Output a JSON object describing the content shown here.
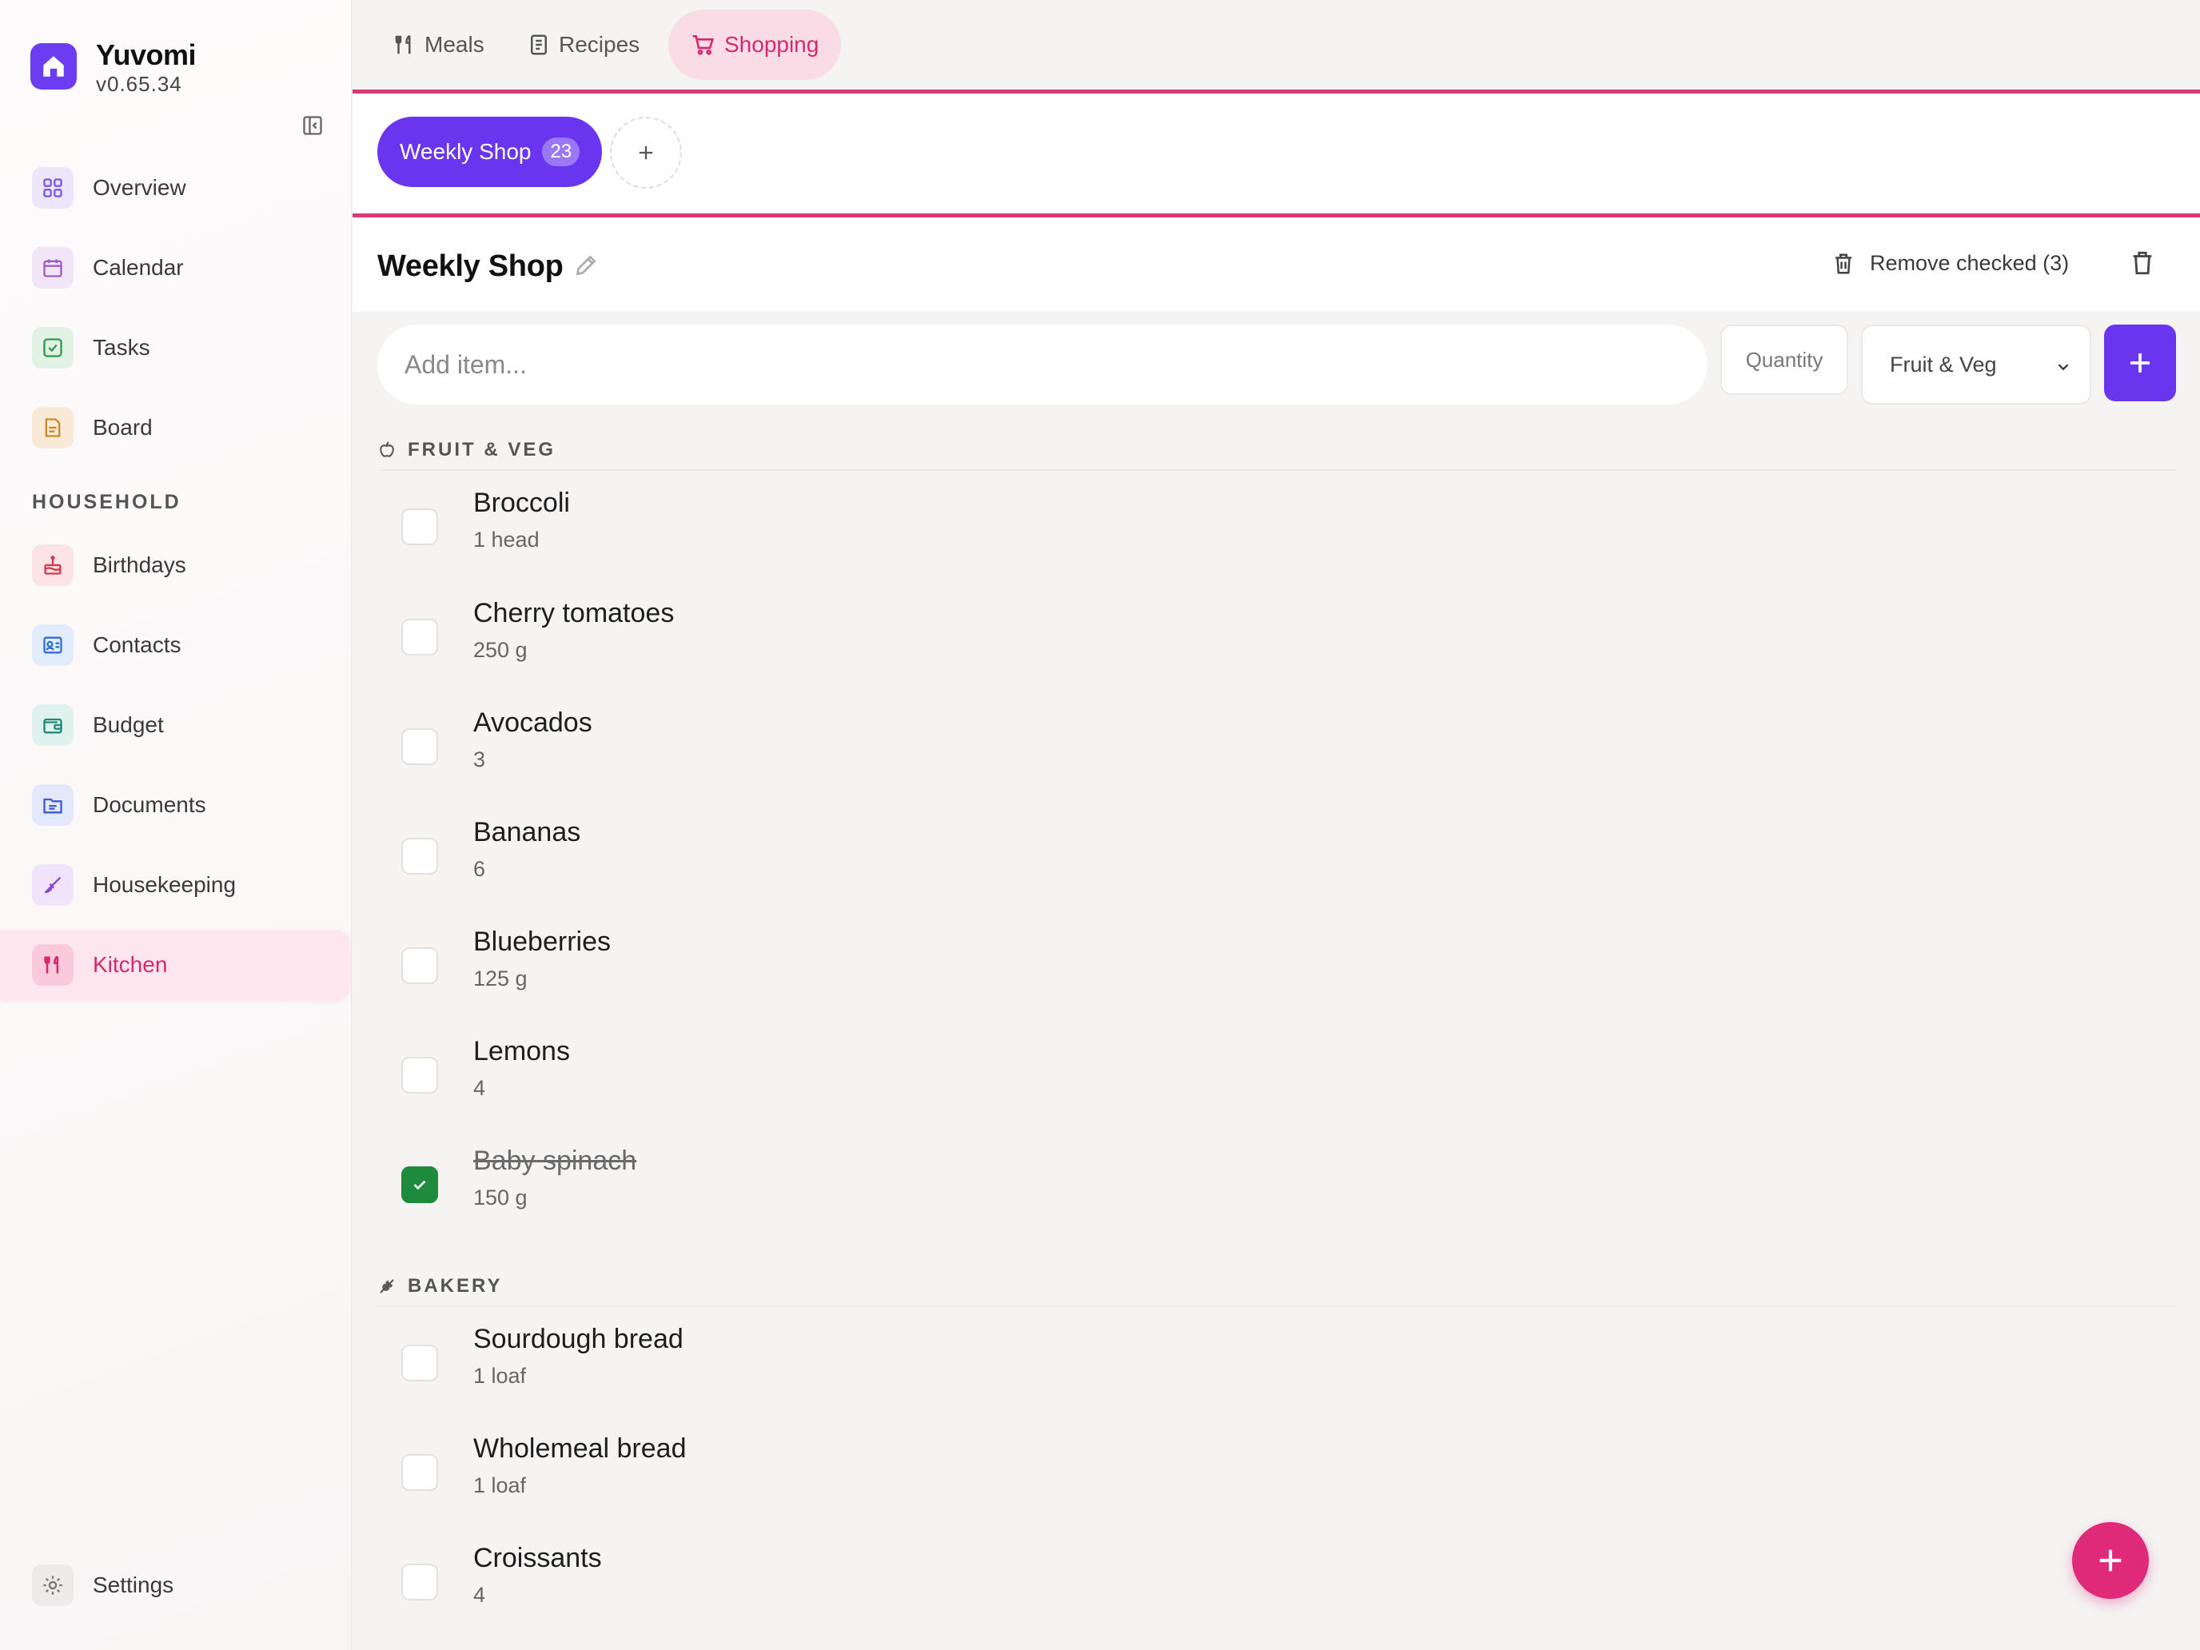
{
  "app": {
    "name": "Yuvomi",
    "version": "v0.65.34"
  },
  "sidebar": {
    "items": [
      {
        "label": "Overview",
        "icon": "grid-icon"
      },
      {
        "label": "Calendar",
        "icon": "calendar-icon"
      },
      {
        "label": "Tasks",
        "icon": "check-square-icon"
      },
      {
        "label": "Board",
        "icon": "note-icon"
      }
    ],
    "section_label": "HOUSEHOLD",
    "household": [
      {
        "label": "Birthdays",
        "icon": "cake-icon"
      },
      {
        "label": "Contacts",
        "icon": "contact-card-icon"
      },
      {
        "label": "Budget",
        "icon": "wallet-icon"
      },
      {
        "label": "Documents",
        "icon": "folder-icon"
      },
      {
        "label": "Housekeeping",
        "icon": "brush-icon"
      },
      {
        "label": "Kitchen",
        "icon": "utensils-icon",
        "active": true
      }
    ],
    "settings_label": "Settings"
  },
  "tabs": [
    {
      "label": "Meals",
      "icon": "utensils-icon"
    },
    {
      "label": "Recipes",
      "icon": "book-icon"
    },
    {
      "label": "Shopping",
      "icon": "cart-icon",
      "active": true
    }
  ],
  "lists": [
    {
      "name": "Weekly Shop",
      "count": "23",
      "active": true
    }
  ],
  "list": {
    "title": "Weekly Shop",
    "remove_checked_label": "Remove checked (3)"
  },
  "add_item": {
    "placeholder": "Add item...",
    "quantity_placeholder": "Quantity",
    "category_selected": "Fruit & Veg"
  },
  "categories": [
    {
      "name": "FRUIT & VEG",
      "icon": "apple-icon",
      "items": [
        {
          "name": "Broccoli",
          "qty": "1 head",
          "checked": false
        },
        {
          "name": "Cherry tomatoes",
          "qty": "250 g",
          "checked": false
        },
        {
          "name": "Avocados",
          "qty": "3",
          "checked": false
        },
        {
          "name": "Bananas",
          "qty": "6",
          "checked": false
        },
        {
          "name": "Blueberries",
          "qty": "125 g",
          "checked": false
        },
        {
          "name": "Lemons",
          "qty": "4",
          "checked": false
        },
        {
          "name": "Baby spinach",
          "qty": "150 g",
          "checked": true
        }
      ]
    },
    {
      "name": "BAKERY",
      "icon": "wheat-icon",
      "items": [
        {
          "name": "Sourdough bread",
          "qty": "1 loaf",
          "checked": false
        },
        {
          "name": "Wholemeal bread",
          "qty": "1 loaf",
          "checked": false
        },
        {
          "name": "Croissants",
          "qty": "4",
          "checked": false
        }
      ]
    }
  ],
  "colors": {
    "accent": "#6a35ef",
    "pink": "#d6286f",
    "checked_green": "#1e8a3c"
  }
}
